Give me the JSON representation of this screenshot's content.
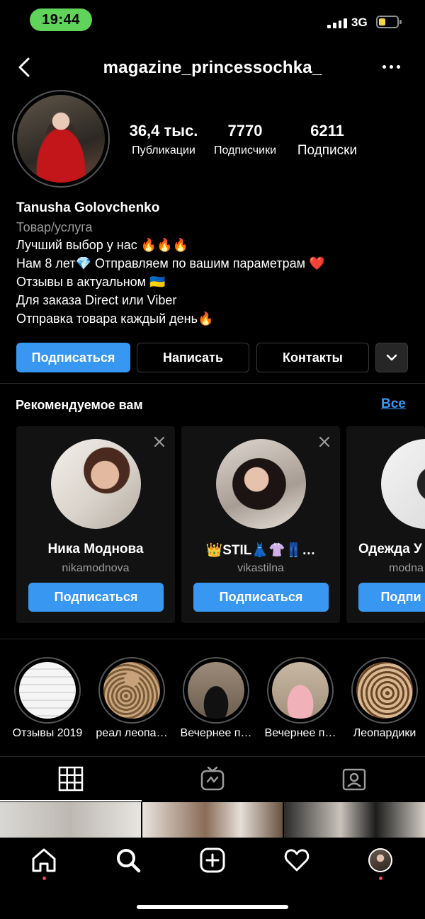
{
  "status_bar": {
    "time": "19:44",
    "network": "3G"
  },
  "header": {
    "username": "magazine_princessochka_"
  },
  "profile": {
    "stats": [
      {
        "value": "36,4 тыс.",
        "label": "Публикации"
      },
      {
        "value": "7770",
        "label": "Подписчики"
      },
      {
        "value": "6211",
        "label": "Подписки"
      }
    ],
    "name": "Tanusha Golovchenko",
    "category": "Товар/услуга",
    "bio": [
      "Лучший выбор у нас 🔥🔥🔥",
      "Нам 8 лет💎 Отправляем по вашим параметрам ❤️",
      "Отзывы в актуальном 🇺🇦",
      "Для заказа Direct или Viber",
      "Отправка товара каждый день🔥"
    ]
  },
  "actions": {
    "follow": "Подписаться",
    "message": "Написать",
    "contacts": "Контакты"
  },
  "suggestions": {
    "title": "Рекомендуемое вам",
    "see_all": "Все",
    "cards": [
      {
        "name": "Ника Моднова",
        "handle": "nikamodnova",
        "button": "Подписаться"
      },
      {
        "name": "👑STIL👗👚👖…",
        "handle": "vikastilna",
        "button": "Подписаться"
      },
      {
        "name": "Одежда У",
        "handle": "modna",
        "button": "Подпи"
      }
    ]
  },
  "highlights": [
    {
      "label": "Отзывы 2019"
    },
    {
      "label": "реал леопа…"
    },
    {
      "label": "Вечернее п…"
    },
    {
      "label": "Вечернее п…"
    },
    {
      "label": "Леопардики"
    }
  ],
  "colors": {
    "accent": "#3897f0",
    "background": "#000000",
    "notification_dot": "#ed4956",
    "time_pill": "#5fd35a"
  }
}
